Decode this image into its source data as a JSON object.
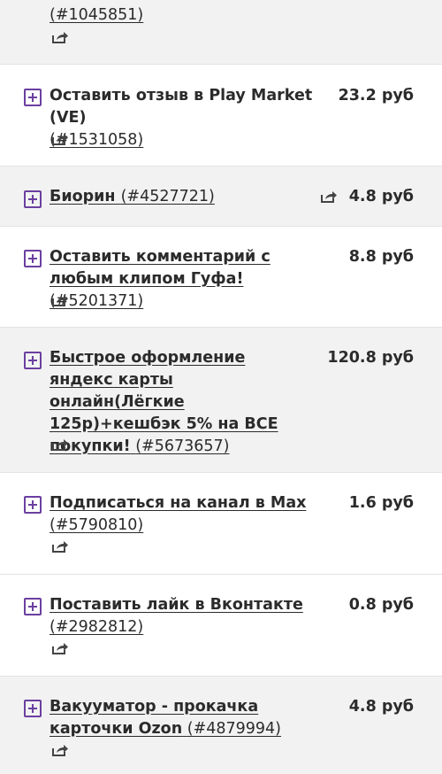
{
  "currency": "руб",
  "tasks": [
    {
      "name": "",
      "id": "(#1045851)",
      "price": "",
      "share_icon": "share-icon"
    },
    {
      "name": "Оставить отзыв в Play Market (VE)",
      "id": "(#1531058)",
      "price": "23.2 руб",
      "share_icon": "share-icon"
    },
    {
      "name": "Биорин ",
      "id": "(#4527721)",
      "price": "4.8 руб",
      "share_icon": "share-icon"
    },
    {
      "name": "Оставить комментарий с любым клипом Гуфа!",
      "id": "(#5201371)",
      "price": "8.8 руб",
      "share_icon": "share-icon"
    },
    {
      "name": "Быстрое оформление яндекс карты онлайн(Лёгкие 125р)+кешбэк 5% на ВСЕ покупки!",
      "id": "(#5673657)",
      "price": "120.8 руб",
      "share_icon": "share-icon"
    },
    {
      "name": "Подписаться на канал в Max",
      "id": "(#5790810)",
      "price": "1.6 руб",
      "share_icon": "share-icon"
    },
    {
      "name": "Поставить лайк в Вконтакте",
      "id": "(#2982812)",
      "price": "0.8 руб",
      "share_icon": "share-icon"
    },
    {
      "name": "Вакууматор - прокачка карточки Ozon",
      "id": "(#4879994)",
      "price": "4.8 руб",
      "share_icon": "share-icon"
    }
  ]
}
